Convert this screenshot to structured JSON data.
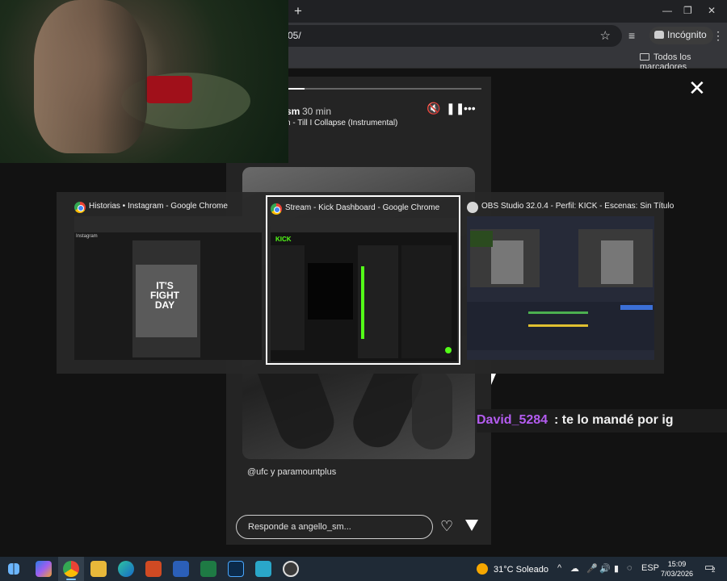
{
  "browser": {
    "new_tab": "+",
    "minimize": "—",
    "restore": "❐",
    "close": "✕",
    "url": "05/",
    "incognito_label": "Incógnito",
    "bookmarks_all": "Todos los marcadores"
  },
  "story": {
    "username_fragment": "sm",
    "time": "30 min",
    "song": "n - Till I Collapse (Instrumental)",
    "mention": "@ufc y paramountplus",
    "reply_placeholder": "Responde a angello_sm...",
    "progress": 0.28
  },
  "chat": {
    "user": "David_5284",
    "message": ": te lo mandé por ig"
  },
  "switcher": {
    "windows": [
      {
        "title": "Historias • Instagram - Google Chrome",
        "app": "chrome-icon",
        "selected": false
      },
      {
        "title": "Stream - Kick Dashboard - Google Chrome",
        "app": "chrome-icon",
        "selected": true
      },
      {
        "title": "OBS Studio 32.0.4 - Perfil: KICK - Escenas: Sin Título",
        "app": "obs-icon",
        "selected": false
      }
    ],
    "thumb_ig_label": "Instagram",
    "thumb_ig_poster": "IT'S FIGHT DAY",
    "thumb_kick_logo": "KICK"
  },
  "taskbar": {
    "weather_temp": "31°C",
    "weather_text": "Soleado",
    "lang": "ESP",
    "time": "15:09",
    "date": "7/03/2026",
    "notifications": "2"
  },
  "colors": {
    "chat_user": "#b45cf0",
    "kick_green": "#53fc18",
    "accent": "#7fc3ff"
  }
}
